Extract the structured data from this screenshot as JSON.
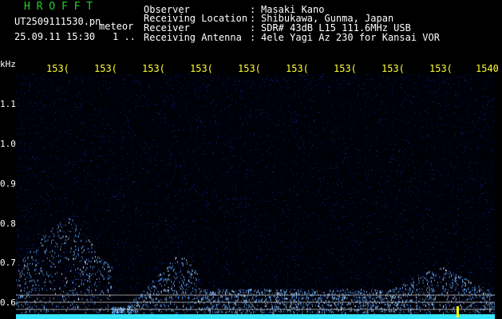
{
  "header": {
    "app_title": "H R O F F T",
    "filename": "UT2509111530.pn",
    "mode_label": "meteor",
    "timestamp": "25.09.11 15:30",
    "page_indicator": "1 .."
  },
  "info": [
    {
      "label": "Observer",
      "sep": ":",
      "value": "Masaki Kano"
    },
    {
      "label": "Receiving Location",
      "sep": ":",
      "value": "Shibukawa, Gunma, Japan"
    },
    {
      "label": "Receiver",
      "sep": ":",
      "value": "SDR# 43dB L15 111.6MHz USB"
    },
    {
      "label": "Receiving Antenna",
      "sep": ":",
      "value": "4ele Yagi Az 230 for Kansai VOR"
    }
  ],
  "y_axis": {
    "unit": "kHz",
    "ticks": [
      "1.1",
      "1.0",
      "0.9",
      "0.8",
      "0.7",
      "0.6"
    ]
  },
  "x_axis": {
    "ticks": [
      "153(",
      "153(",
      "153(",
      "153(",
      "153(",
      "153(",
      "153(",
      "153(",
      "153(",
      "1540"
    ]
  },
  "colors": {
    "background": "#000000",
    "waterfall_noise": "#1a2fb4",
    "meteor_echo": "#58a8ff",
    "carrier_line": "#39e6ff",
    "title_green": "#23d12a",
    "tick_yellow": "#ffff33",
    "marker_yellow": "#ffff00"
  }
}
